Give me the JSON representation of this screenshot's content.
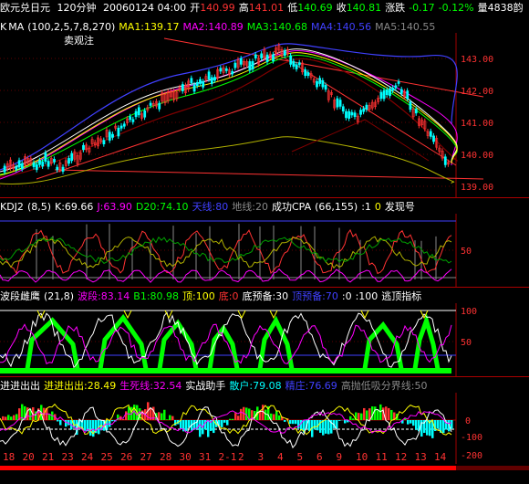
{
  "header": {
    "symbol": "欧元兑日元",
    "period": "120分钟",
    "datetime": "20060124 04:00",
    "open_label": "开",
    "open": "140.99",
    "high_label": "高",
    "high": "141.01",
    "low_label": "低",
    "low": "140.69",
    "close_label": "收",
    "close": "140.81",
    "change_label": "涨跌",
    "change": "-0.17",
    "change_pct": "-0.12%",
    "volume_label": "量",
    "volume": "4838",
    "extra": "韵"
  },
  "price_panel": {
    "ma_header": [
      "K",
      "MA",
      "(100,2,5,7,8,270)",
      "MA1:139.17",
      "MA2:140.89",
      "MA3:140.68",
      "MA4:140.56",
      "MA5:140.55"
    ],
    "annotation": "卖观注",
    "y_ticks": [
      "143.00",
      "142.00",
      "141.00",
      "140.00",
      "139.00"
    ]
  },
  "kdj_panel": {
    "header": [
      "KDJ2",
      "(8,5)",
      "K:69.66",
      "J:63.90",
      "D20:74.10",
      "天线:80",
      "地线:20",
      "成功CPA",
      "(66,155)",
      ":1",
      "0",
      "发现号"
    ],
    "y_ticks": [
      "50"
    ]
  },
  "wave_panel": {
    "header": [
      "波段雌鹰",
      "(21,8)",
      "波段:83.14",
      "B1:80.98",
      "顶:100",
      "底:0",
      "底预备:30",
      "顶预备:70",
      ":0",
      ":100",
      "逃顶指标"
    ],
    "y_ticks": [
      "100",
      "50"
    ]
  },
  "entry_panel": {
    "header": [
      "进进出出",
      "进进出出:28.49",
      "生死线:32.54",
      "实战助手",
      "散户:79.08",
      "精庄:76.69",
      "高抛低吸分界线:50"
    ],
    "y_ticks": [
      "0",
      "-100",
      "-200"
    ]
  },
  "x_axis": {
    "labels": [
      "18",
      "20",
      "21",
      "23",
      "24",
      "25",
      "26",
      "27",
      "28",
      "30",
      "31",
      "2-1",
      "2",
      "3",
      "4",
      "5",
      "6",
      "9",
      "10",
      "11",
      "12",
      "13",
      "14"
    ]
  },
  "colors": {
    "up": "#ff3232",
    "down": "#00ffff",
    "ma_white": "#ffffff",
    "ma_yellow": "#ffff00",
    "ma_magenta": "#ff00ff",
    "ma_green": "#00ff00",
    "ma_blue": "#4040ff",
    "grid": "#a00000",
    "fill_green": "#00ff00",
    "fill_cyan": "#00ffff"
  }
}
